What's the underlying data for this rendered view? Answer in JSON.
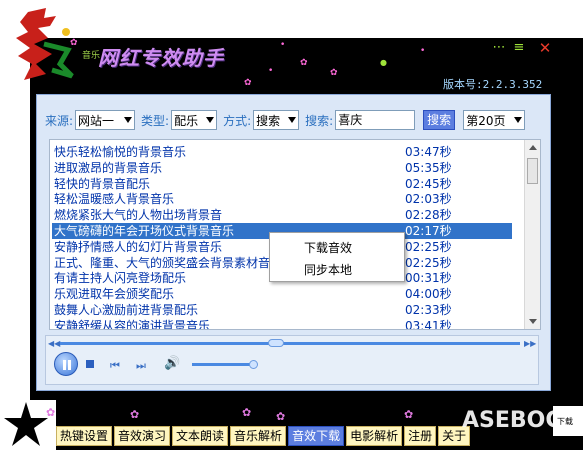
{
  "app": {
    "title": "网红专效助手",
    "title_small": "音乐",
    "version": "版本号:2.2.3.352"
  },
  "window_controls": {
    "menu": "⋯",
    "list": "≡",
    "close": "✕"
  },
  "search": {
    "source_label": "来源:",
    "source_value": "网站一",
    "type_label": "类型:",
    "type_value": "配乐",
    "mode_label": "方式:",
    "mode_value": "搜索",
    "keyword_label": "搜索:",
    "keyword_value": "喜庆",
    "search_button": "搜索",
    "page_value": "第20页"
  },
  "songs": [
    {
      "name": "快乐轻松愉悦的背景音乐",
      "duration": "03:47秒"
    },
    {
      "name": "进取激昂的背景音乐",
      "duration": "05:35秒"
    },
    {
      "name": "轻快的背景音配乐",
      "duration": "02:45秒"
    },
    {
      "name": "轻松温暖感人背景音乐",
      "duration": "02:03秒"
    },
    {
      "name": "燃烧紧张大气的人物出场背景音",
      "duration": "02:28秒"
    },
    {
      "name": "大气磅礴的年会开场仪式背景音乐",
      "duration": "02:17秒",
      "selected": true
    },
    {
      "name": "安静抒情感人的幻灯片背景音乐",
      "duration": "02:25秒"
    },
    {
      "name": "正式、隆重、大气的颁奖盛会背景素材音",
      "duration": "02:25秒"
    },
    {
      "name": "有请主持人闪亮登场配乐",
      "duration": "00:31秒"
    },
    {
      "name": "乐观进取年会颁奖配乐",
      "duration": "04:00秒"
    },
    {
      "name": "鼓舞人心激励前进背景配乐",
      "duration": "02:33秒"
    },
    {
      "name": "安静舒缓从容的演讲背景音乐",
      "duration": "03:41秒"
    }
  ],
  "context_menu": {
    "download": "下载音效",
    "sync_local": "同步本地"
  },
  "player": {
    "seek_progress": 0.47,
    "volume": 0.95
  },
  "tabs": [
    {
      "label": "热键设置"
    },
    {
      "label": "音效演习"
    },
    {
      "label": "文本朗读"
    },
    {
      "label": "音乐解析"
    },
    {
      "label": "音效下载",
      "active": true
    },
    {
      "label": "电影解析"
    },
    {
      "label": "注册"
    },
    {
      "label": "关于"
    }
  ],
  "watermark": {
    "text": "ASEBOC",
    "corner": "下载"
  },
  "colors": {
    "accent": "#5c7ee0",
    "selection": "#3173c9",
    "panel": "#dbe7f7",
    "frame": "#000000",
    "tab": "#fff6c0"
  }
}
